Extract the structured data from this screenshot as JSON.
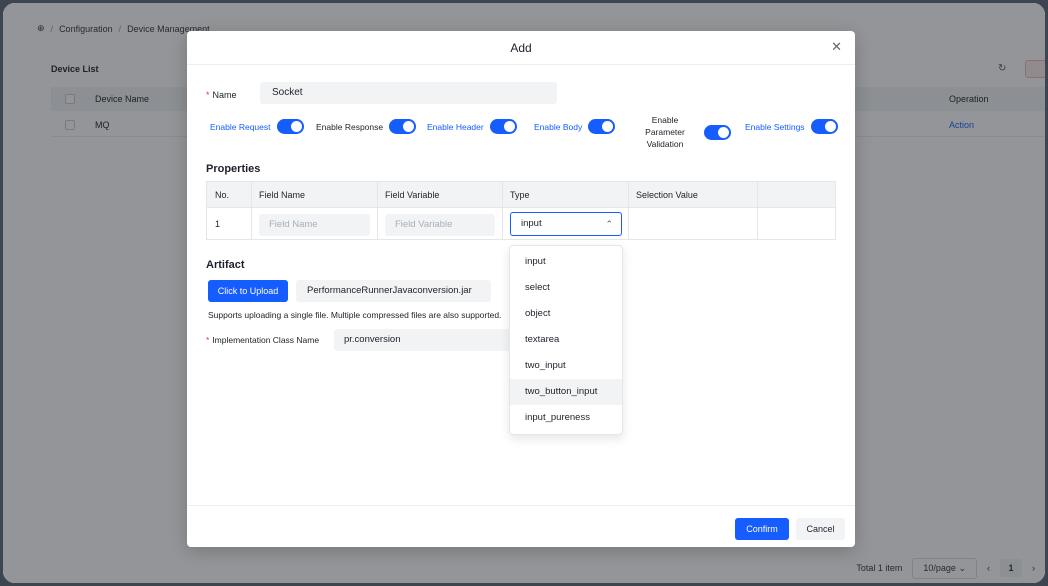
{
  "background": {
    "breadcrumb": [
      "Configuration",
      "Device Management"
    ],
    "card_title": "Device List",
    "table": {
      "headers": [
        "Device Name",
        "Operation"
      ],
      "rows": [
        {
          "name": "MQ",
          "action": "Action"
        }
      ]
    },
    "footer": {
      "total": "Total 1 item",
      "page_size": "10/page",
      "page": "1"
    }
  },
  "modal": {
    "title": "Add",
    "close_icon": "close-icon",
    "name": {
      "label": "Name",
      "value": "Socket"
    },
    "toggles": [
      {
        "label": "Enable Request",
        "on": true
      },
      {
        "label": "Enable Response",
        "on": true
      },
      {
        "label": "Enable Header",
        "on": true
      },
      {
        "label": "Enable Body",
        "on": true
      },
      {
        "label": "Enable Parameter Validation",
        "on": true
      },
      {
        "label": "Enable Settings",
        "on": true
      }
    ],
    "properties": {
      "title": "Properties",
      "headers": [
        "No.",
        "Field Name",
        "Field Variable",
        "Type",
        "Selection Value"
      ],
      "row": {
        "no": "1",
        "field_name_placeholder": "Field Name",
        "field_variable_placeholder": "Field Variable",
        "type": "input"
      }
    },
    "type_options": [
      "input",
      "select",
      "object",
      "textarea",
      "two_input",
      "two_button_input",
      "input_pureness"
    ],
    "artifact": {
      "title": "Artifact",
      "upload_label": "Click to Upload",
      "file_name": "PerformanceRunnerJavaconversion.jar",
      "hint": "Supports uploading a single file. Multiple compressed files are also supported.",
      "impl_label": "Implementation Class Name",
      "impl_value": "pr.conversion"
    },
    "buttons": {
      "confirm": "Confirm",
      "cancel": "Cancel"
    },
    "accent_color": "#165dff"
  }
}
